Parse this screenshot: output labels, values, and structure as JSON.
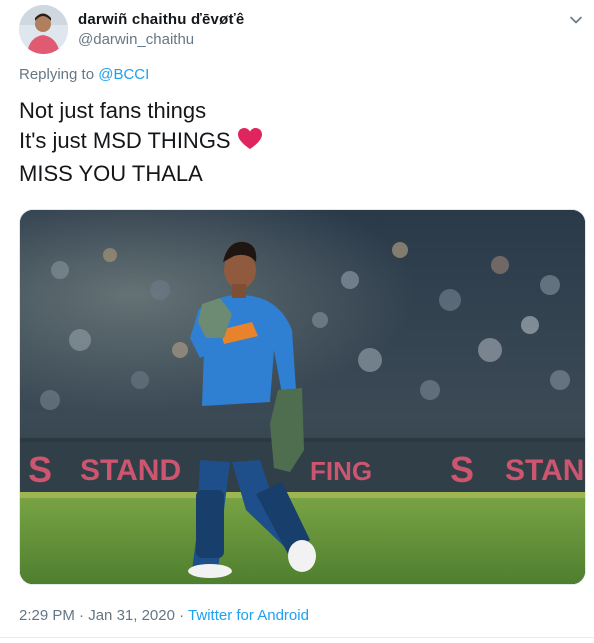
{
  "tweet": {
    "display_name": "darwiñ chaithu ďēvøťê",
    "handle": "@darwin_chaithu",
    "replying_prefix": "Replying to",
    "replying_to": "@BCCI",
    "text_lines": [
      "Not just fans things",
      "It's just MSD THINGS",
      "MISS YOU THALA"
    ],
    "emoji": "heart",
    "image": {
      "stadium_board_texts": [
        "STAND",
        "FING",
        "STAN"
      ]
    },
    "time": "2:29 PM",
    "separator": "·",
    "date": "Jan 31, 2020",
    "source": "Twitter for Android"
  },
  "colors": {
    "text": "#14171a",
    "secondary": "#657786",
    "link": "#1da1f2",
    "heart": "#e0245e"
  },
  "icons": {
    "caret": "chevron-down-icon",
    "heart": "heart-icon"
  }
}
